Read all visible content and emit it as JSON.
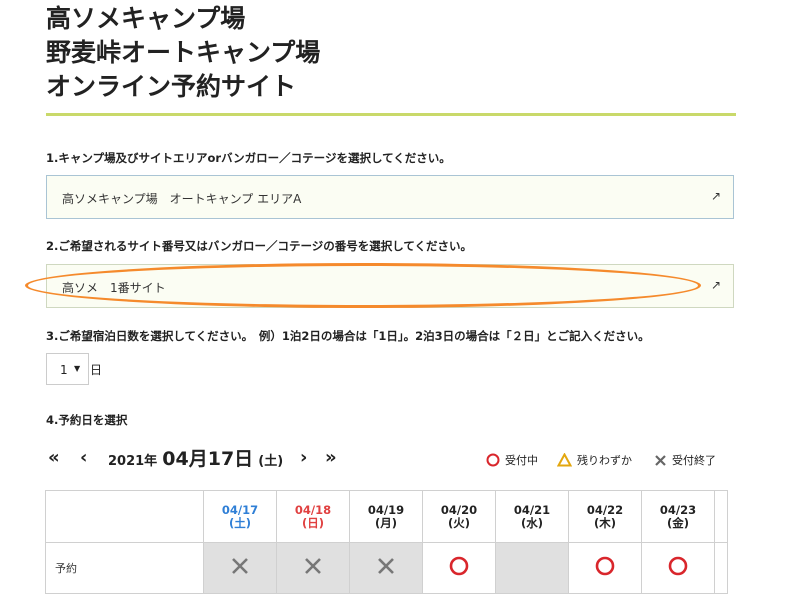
{
  "header": {
    "title_lines": [
      "高ソメキャンプ場",
      "野麦峠オートキャンプ場",
      "オンライン予約サイト"
    ]
  },
  "steps": {
    "step1": "1.キャンプ場及びサイトエリアorバンガロー／コテージを選択してください。",
    "step2": "2.ご希望されるサイト番号又はバンガロー／コテージの番号を選択してください。",
    "step3": "3.ご希望宿泊日数を選択してください。　例）1泊2日の場合は「1日」。2泊3日の場合は「２日」とご記入ください。",
    "step4": "4.予約日を選択"
  },
  "area_select": {
    "value": "高ソメキャンプ場　オートキャンプ エリアA",
    "icon": "external-arrow-icon"
  },
  "site_select": {
    "value": "高ソメ　1番サイト",
    "icon": "external-arrow-icon"
  },
  "nights": {
    "value": "1",
    "unit": "日"
  },
  "calendar_nav": {
    "first": "«",
    "prev": "‹",
    "next": "›",
    "last": "»",
    "year": "2021年",
    "month_day": "04月17日",
    "weekday": "(土)"
  },
  "legend": {
    "open_label": "受付中",
    "few_label": "残りわずか",
    "closed_label": "受付終了",
    "colors": {
      "open": "#d9262c",
      "few": "#e3a70f",
      "closed": "#666666"
    }
  },
  "calendar": {
    "row_label": "予約",
    "days": [
      {
        "date": "04/17",
        "weekday": "(土)",
        "type": "sat",
        "status": "closed"
      },
      {
        "date": "04/18",
        "weekday": "(日)",
        "type": "sun",
        "status": "closed"
      },
      {
        "date": "04/19",
        "weekday": "(月)",
        "type": "weekday",
        "status": "closed"
      },
      {
        "date": "04/20",
        "weekday": "(火)",
        "type": "weekday",
        "status": "open"
      },
      {
        "date": "04/21",
        "weekday": "(水)",
        "type": "weekday",
        "status": "none"
      },
      {
        "date": "04/22",
        "weekday": "(木)",
        "type": "weekday",
        "status": "open"
      },
      {
        "date": "04/23",
        "weekday": "(金)",
        "type": "weekday",
        "status": "open"
      }
    ]
  }
}
